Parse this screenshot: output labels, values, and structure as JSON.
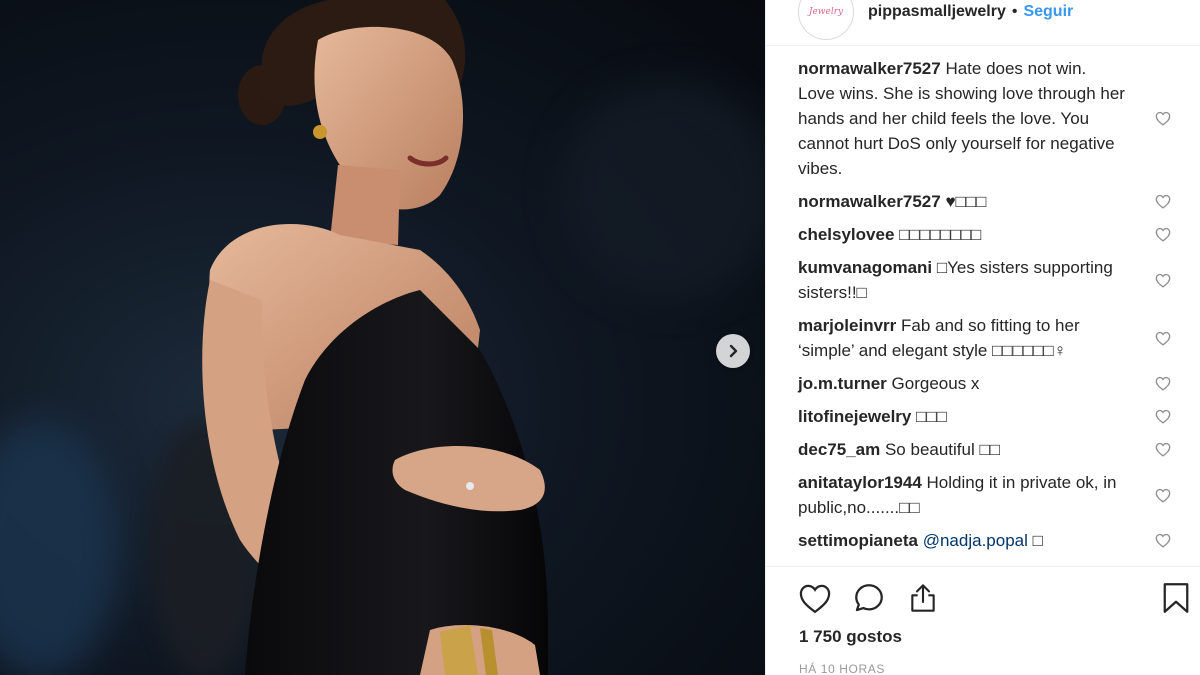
{
  "post": {
    "username": "pippasmalljewelry",
    "follow_label": "Seguir",
    "avatar_text": "Jewelry"
  },
  "comments": [
    {
      "user": "normawalker7527",
      "text": "Hate does not win. Love wins. She is showing love through her hands and her child feels the love. You cannot hurt DoS only yourself for negative vibes."
    },
    {
      "user": "normawalker7527",
      "text": "♥□□□"
    },
    {
      "user": "chelsylovee",
      "text": "□□□□□□□□"
    },
    {
      "user": "kumvanagomani",
      "text": "□Yes sisters supporting sisters!!□"
    },
    {
      "user": "marjoleinvrr",
      "text": "Fab and so fitting to her ‘simple’ and elegant style □□□□□□♀"
    },
    {
      "user": "jo.m.turner",
      "text": "Gorgeous x"
    },
    {
      "user": "litofinejewelry",
      "text": "□□□"
    },
    {
      "user": "dec75_am",
      "text": "So beautiful □□"
    },
    {
      "user": "anitataylor1944",
      "text": "Holding it in private ok, in public,no.......□□"
    },
    {
      "user": "settimopianeta",
      "mention": "@nadja.popal",
      "text": " □"
    }
  ],
  "likes_text": "1 750 gostos",
  "timestamp": "HÁ 10 HORAS",
  "icons": {
    "next": "chevron-right-icon",
    "like": "heart-outline-icon",
    "comment": "comment-bubble-icon",
    "share": "share-upload-icon",
    "save": "bookmark-icon",
    "comment_like": "heart-small-icon"
  },
  "colors": {
    "link_blue": "#3897f0",
    "mention_blue": "#003569",
    "text": "#262626",
    "muted": "#999999"
  }
}
